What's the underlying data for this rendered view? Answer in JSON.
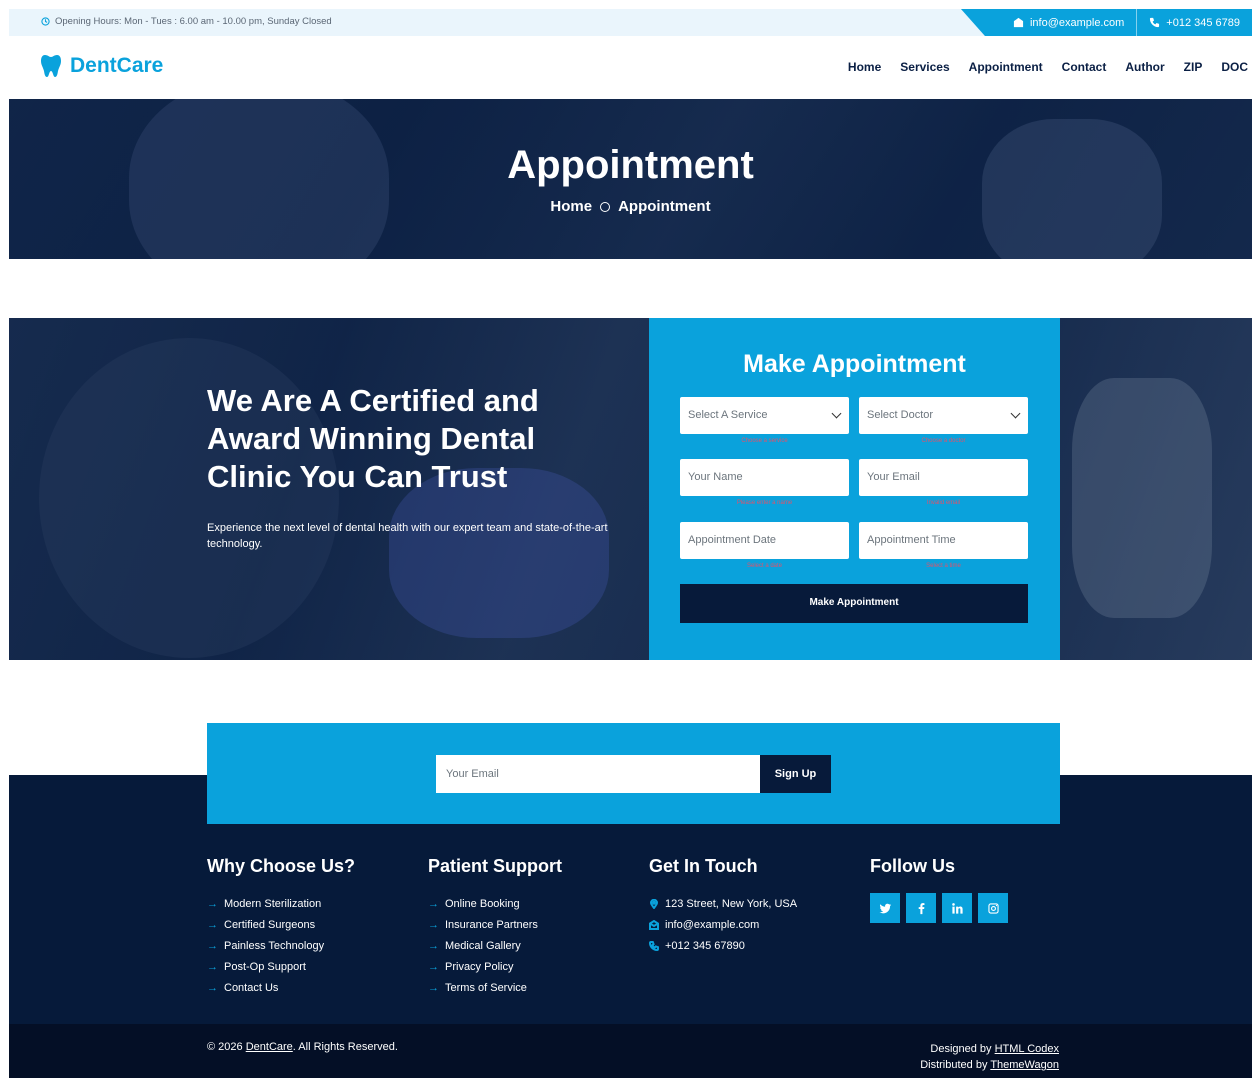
{
  "topbar": {
    "hours": "Opening Hours: Mon - Tues : 6.00 am - 10.00 pm, Sunday Closed",
    "email": "info@example.com",
    "phone": "+012 345 6789"
  },
  "brand": {
    "name": "DentCare",
    "icon": "tooth-icon"
  },
  "menu": [
    "Home",
    "Services",
    "Appointment",
    "Contact",
    "Author",
    "ZIP",
    "DOC"
  ],
  "hero": {
    "title": "Appointment",
    "breadcrumb": [
      "Home",
      "Appointment"
    ]
  },
  "appointment": {
    "headline": "We Are A Certified and Award Winning Dental Clinic You Can Trust",
    "description": "Experience the next level of dental health with our expert team and state-of-the-art technology.",
    "form": {
      "title": "Make Appointment",
      "service_placeholder": "Select A Service",
      "doctor_placeholder": "Select Doctor",
      "name_placeholder": "Your Name",
      "email_placeholder": "Your Email",
      "date_placeholder": "Appointment Date",
      "time_placeholder": "Appointment Time",
      "service_error": "Choose a service",
      "doctor_error": "Choose a doctor",
      "name_error": "Please enter a name",
      "email_error": "Invalid email",
      "date_error": "Select a date",
      "time_error": "Select a time",
      "submit_label": "Make Appointment"
    }
  },
  "newsletter": {
    "placeholder": "Your Email",
    "button_label": "Sign Up"
  },
  "footer": {
    "why": {
      "title": "Why Choose Us?",
      "items": [
        "Modern Sterilization",
        "Certified Surgeons",
        "Painless Technology",
        "Post-Op Support",
        "Contact Us"
      ]
    },
    "support": {
      "title": "Patient Support",
      "items": [
        "Online Booking",
        "Insurance Partners",
        "Medical Gallery",
        "Privacy Policy",
        "Terms of Service"
      ]
    },
    "touch": {
      "title": "Get In Touch",
      "address": "123 Street, New York, USA",
      "email": "info@example.com",
      "phone": "+012 345 67890"
    },
    "follow": {
      "title": "Follow Us",
      "networks": [
        "twitter-icon",
        "facebook-icon",
        "linkedin-icon",
        "instagram-icon"
      ]
    }
  },
  "bottom": {
    "copy_prefix": "© 2026 ",
    "copy_link": "DentCare",
    "copy_suffix": ". All Rights Reserved.",
    "designed_prefix": "Designed by ",
    "designed_link": "HTML Codex",
    "distributed_prefix": "Distributed by ",
    "distributed_link": "ThemeWagon"
  },
  "colors": {
    "accent": "#0aa2dc",
    "navy": "#071a3a",
    "footer": "#061a3a"
  }
}
